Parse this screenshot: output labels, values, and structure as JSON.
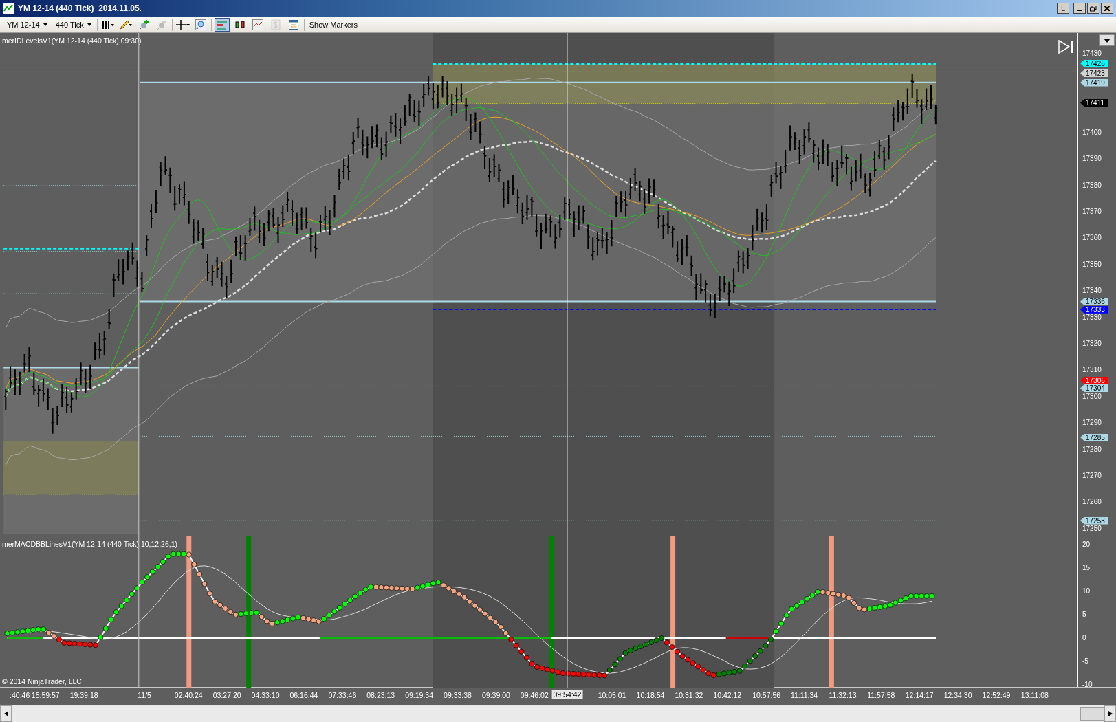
{
  "window": {
    "title": "YM 12-14 (440 Tick)  2014.11.05.",
    "lock_button": "L"
  },
  "toolbar": {
    "instrument": "YM 12-14",
    "period": "440 Tick",
    "show_markers": "Show Markers",
    "toggle_buttons": [
      {
        "kind": "panels",
        "selected": true,
        "disabled": false
      },
      {
        "kind": "candles",
        "selected": false,
        "disabled": false
      },
      {
        "kind": "line",
        "selected": false,
        "disabled": false
      },
      {
        "kind": "dollar",
        "selected": false,
        "disabled": true
      },
      {
        "kind": "properties",
        "selected": false,
        "disabled": false
      }
    ]
  },
  "price_panel": {
    "label": "merIDLevelsV1(YM 12-14 (440 Tick),09:30)",
    "axis_labels": [
      "17430",
      "17400",
      "17390",
      "17380",
      "17370",
      "17360",
      "17350",
      "17340",
      "17330",
      "17320",
      "17310",
      "17300",
      "17290",
      "17280",
      "17270",
      "17260",
      "17250"
    ],
    "price_markers": [
      {
        "value": "17426",
        "color": "#00ffff"
      },
      {
        "value": "17423",
        "color": "#d3d3d3"
      },
      {
        "value": "17419",
        "color": "#add8e6"
      },
      {
        "value": "17411",
        "color": "#000000"
      },
      {
        "value": "17336",
        "color": "#add8e6"
      },
      {
        "value": "17333",
        "color": "#0000ff"
      },
      {
        "value": "17306",
        "color": "#ff0000"
      },
      {
        "value": "17304",
        "color": "#add8e6"
      },
      {
        "value": "17285",
        "color": "#add8e6"
      },
      {
        "value": "17253",
        "color": "#add8e6"
      }
    ]
  },
  "indicator_panel": {
    "label": "merMACDBBLinesV1(YM 12-14 (440 Tick),10,12,26,1)",
    "copyright": "© 2014 NinjaTrader, LLC",
    "axis_labels": [
      "20",
      "15",
      "10",
      "5",
      "0",
      "-5",
      "-10"
    ]
  },
  "time_axis": {
    "labels": [
      ":40:46",
      "15:59:57",
      "19:39:18",
      "11/5",
      "02:40:24",
      "03:27:20",
      "04:33:10",
      "06:16:44",
      "07:33:46",
      "08:23:13",
      "09:19:34",
      "09:33:38",
      "09:39:00",
      "09:46:02",
      "10:05:01",
      "10:18:54",
      "10:31:32",
      "10:42:12",
      "10:57:56",
      "11:11:34",
      "11:32:13",
      "11:57:58",
      "12:14:17",
      "12:34:30",
      "12:52:49",
      "13:11:08"
    ],
    "cursor_label": "09:54:42"
  }
}
